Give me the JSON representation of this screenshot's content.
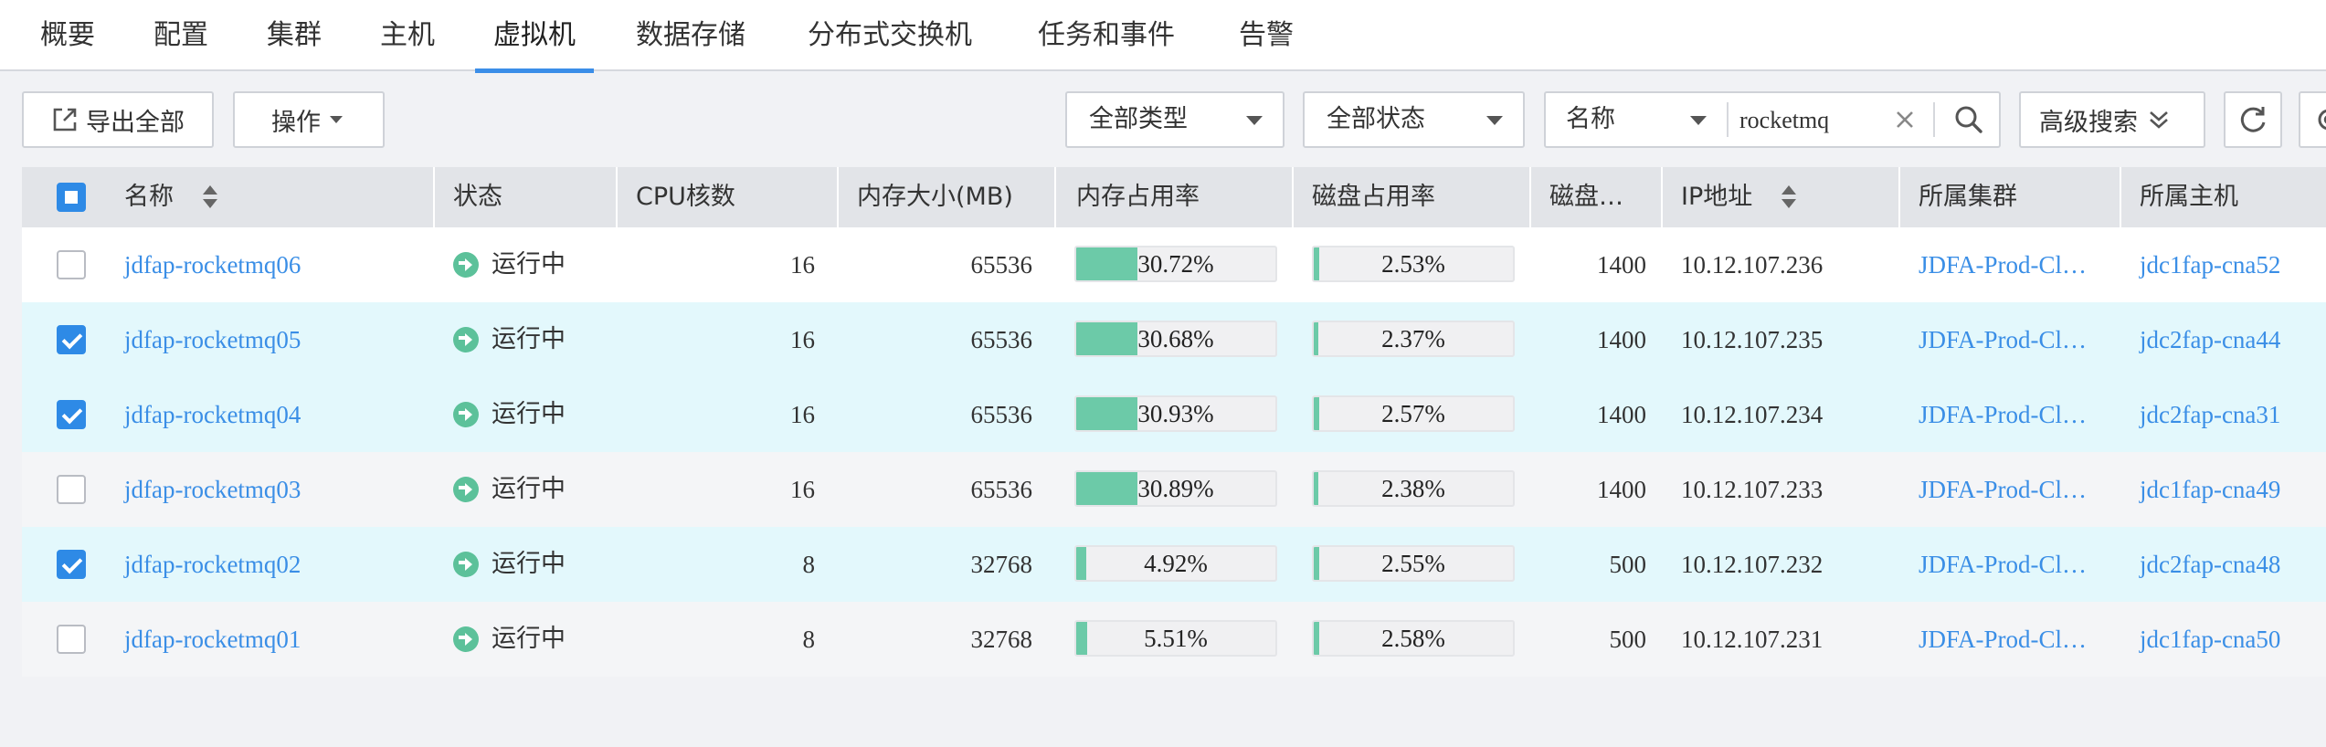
{
  "tabs": [
    "概要",
    "配置",
    "集群",
    "主机",
    "虚拟机",
    "数据存储",
    "分布式交换机",
    "任务和事件",
    "告警"
  ],
  "active_tab": "虚拟机",
  "toolbar": {
    "export_label": "导出全部",
    "ops_label": "操作",
    "type_filter": "全部类型",
    "status_filter": "全部状态",
    "search_field": "名称",
    "search_value": "rocketmq",
    "advanced_label": "高级搜索"
  },
  "columns": {
    "name": "名称",
    "status": "状态",
    "cpu": "CPU核数",
    "mem": "内存大小(MB)",
    "mem_usage": "内存占用率",
    "disk_usage": "磁盘占用率",
    "disk": "磁盘…",
    "ip": "IP地址",
    "cluster": "所属集群",
    "host": "所属主机"
  },
  "colors": {
    "accent": "#3a8ee6",
    "usage_fill": "#6ccaa8",
    "status_running": "#5cc19a",
    "selected_row": "#e3f8fc"
  },
  "rows": [
    {
      "selected": false,
      "name": "jdfap-rocketmq06",
      "status": "运行中",
      "cpu": "16",
      "mem": "65536",
      "mem_usage_text": "30.72%",
      "mem_usage": 30.72,
      "disk_usage_text": "2.53%",
      "disk_usage": 2.53,
      "disk": "1400",
      "ip": "10.12.107.236",
      "cluster": "JDFA-Prod-Cl…",
      "host": "jdc1fap-cna52"
    },
    {
      "selected": true,
      "name": "jdfap-rocketmq05",
      "status": "运行中",
      "cpu": "16",
      "mem": "65536",
      "mem_usage_text": "30.68%",
      "mem_usage": 30.68,
      "disk_usage_text": "2.37%",
      "disk_usage": 2.37,
      "disk": "1400",
      "ip": "10.12.107.235",
      "cluster": "JDFA-Prod-Cl…",
      "host": "jdc2fap-cna44"
    },
    {
      "selected": true,
      "name": "jdfap-rocketmq04",
      "status": "运行中",
      "cpu": "16",
      "mem": "65536",
      "mem_usage_text": "30.93%",
      "mem_usage": 30.93,
      "disk_usage_text": "2.57%",
      "disk_usage": 2.57,
      "disk": "1400",
      "ip": "10.12.107.234",
      "cluster": "JDFA-Prod-Cl…",
      "host": "jdc2fap-cna31"
    },
    {
      "selected": false,
      "name": "jdfap-rocketmq03",
      "status": "运行中",
      "cpu": "16",
      "mem": "65536",
      "mem_usage_text": "30.89%",
      "mem_usage": 30.89,
      "disk_usage_text": "2.38%",
      "disk_usage": 2.38,
      "disk": "1400",
      "ip": "10.12.107.233",
      "cluster": "JDFA-Prod-Cl…",
      "host": "jdc1fap-cna49"
    },
    {
      "selected": true,
      "name": "jdfap-rocketmq02",
      "status": "运行中",
      "cpu": "8",
      "mem": "32768",
      "mem_usage_text": "4.92%",
      "mem_usage": 4.92,
      "disk_usage_text": "2.55%",
      "disk_usage": 2.55,
      "disk": "500",
      "ip": "10.12.107.232",
      "cluster": "JDFA-Prod-Cl…",
      "host": "jdc2fap-cna48"
    },
    {
      "selected": false,
      "name": "jdfap-rocketmq01",
      "status": "运行中",
      "cpu": "8",
      "mem": "32768",
      "mem_usage_text": "5.51%",
      "mem_usage": 5.51,
      "disk_usage_text": "2.58%",
      "disk_usage": 2.58,
      "disk": "500",
      "ip": "10.12.107.231",
      "cluster": "JDFA-Prod-Cl…",
      "host": "jdc1fap-cna50"
    }
  ]
}
